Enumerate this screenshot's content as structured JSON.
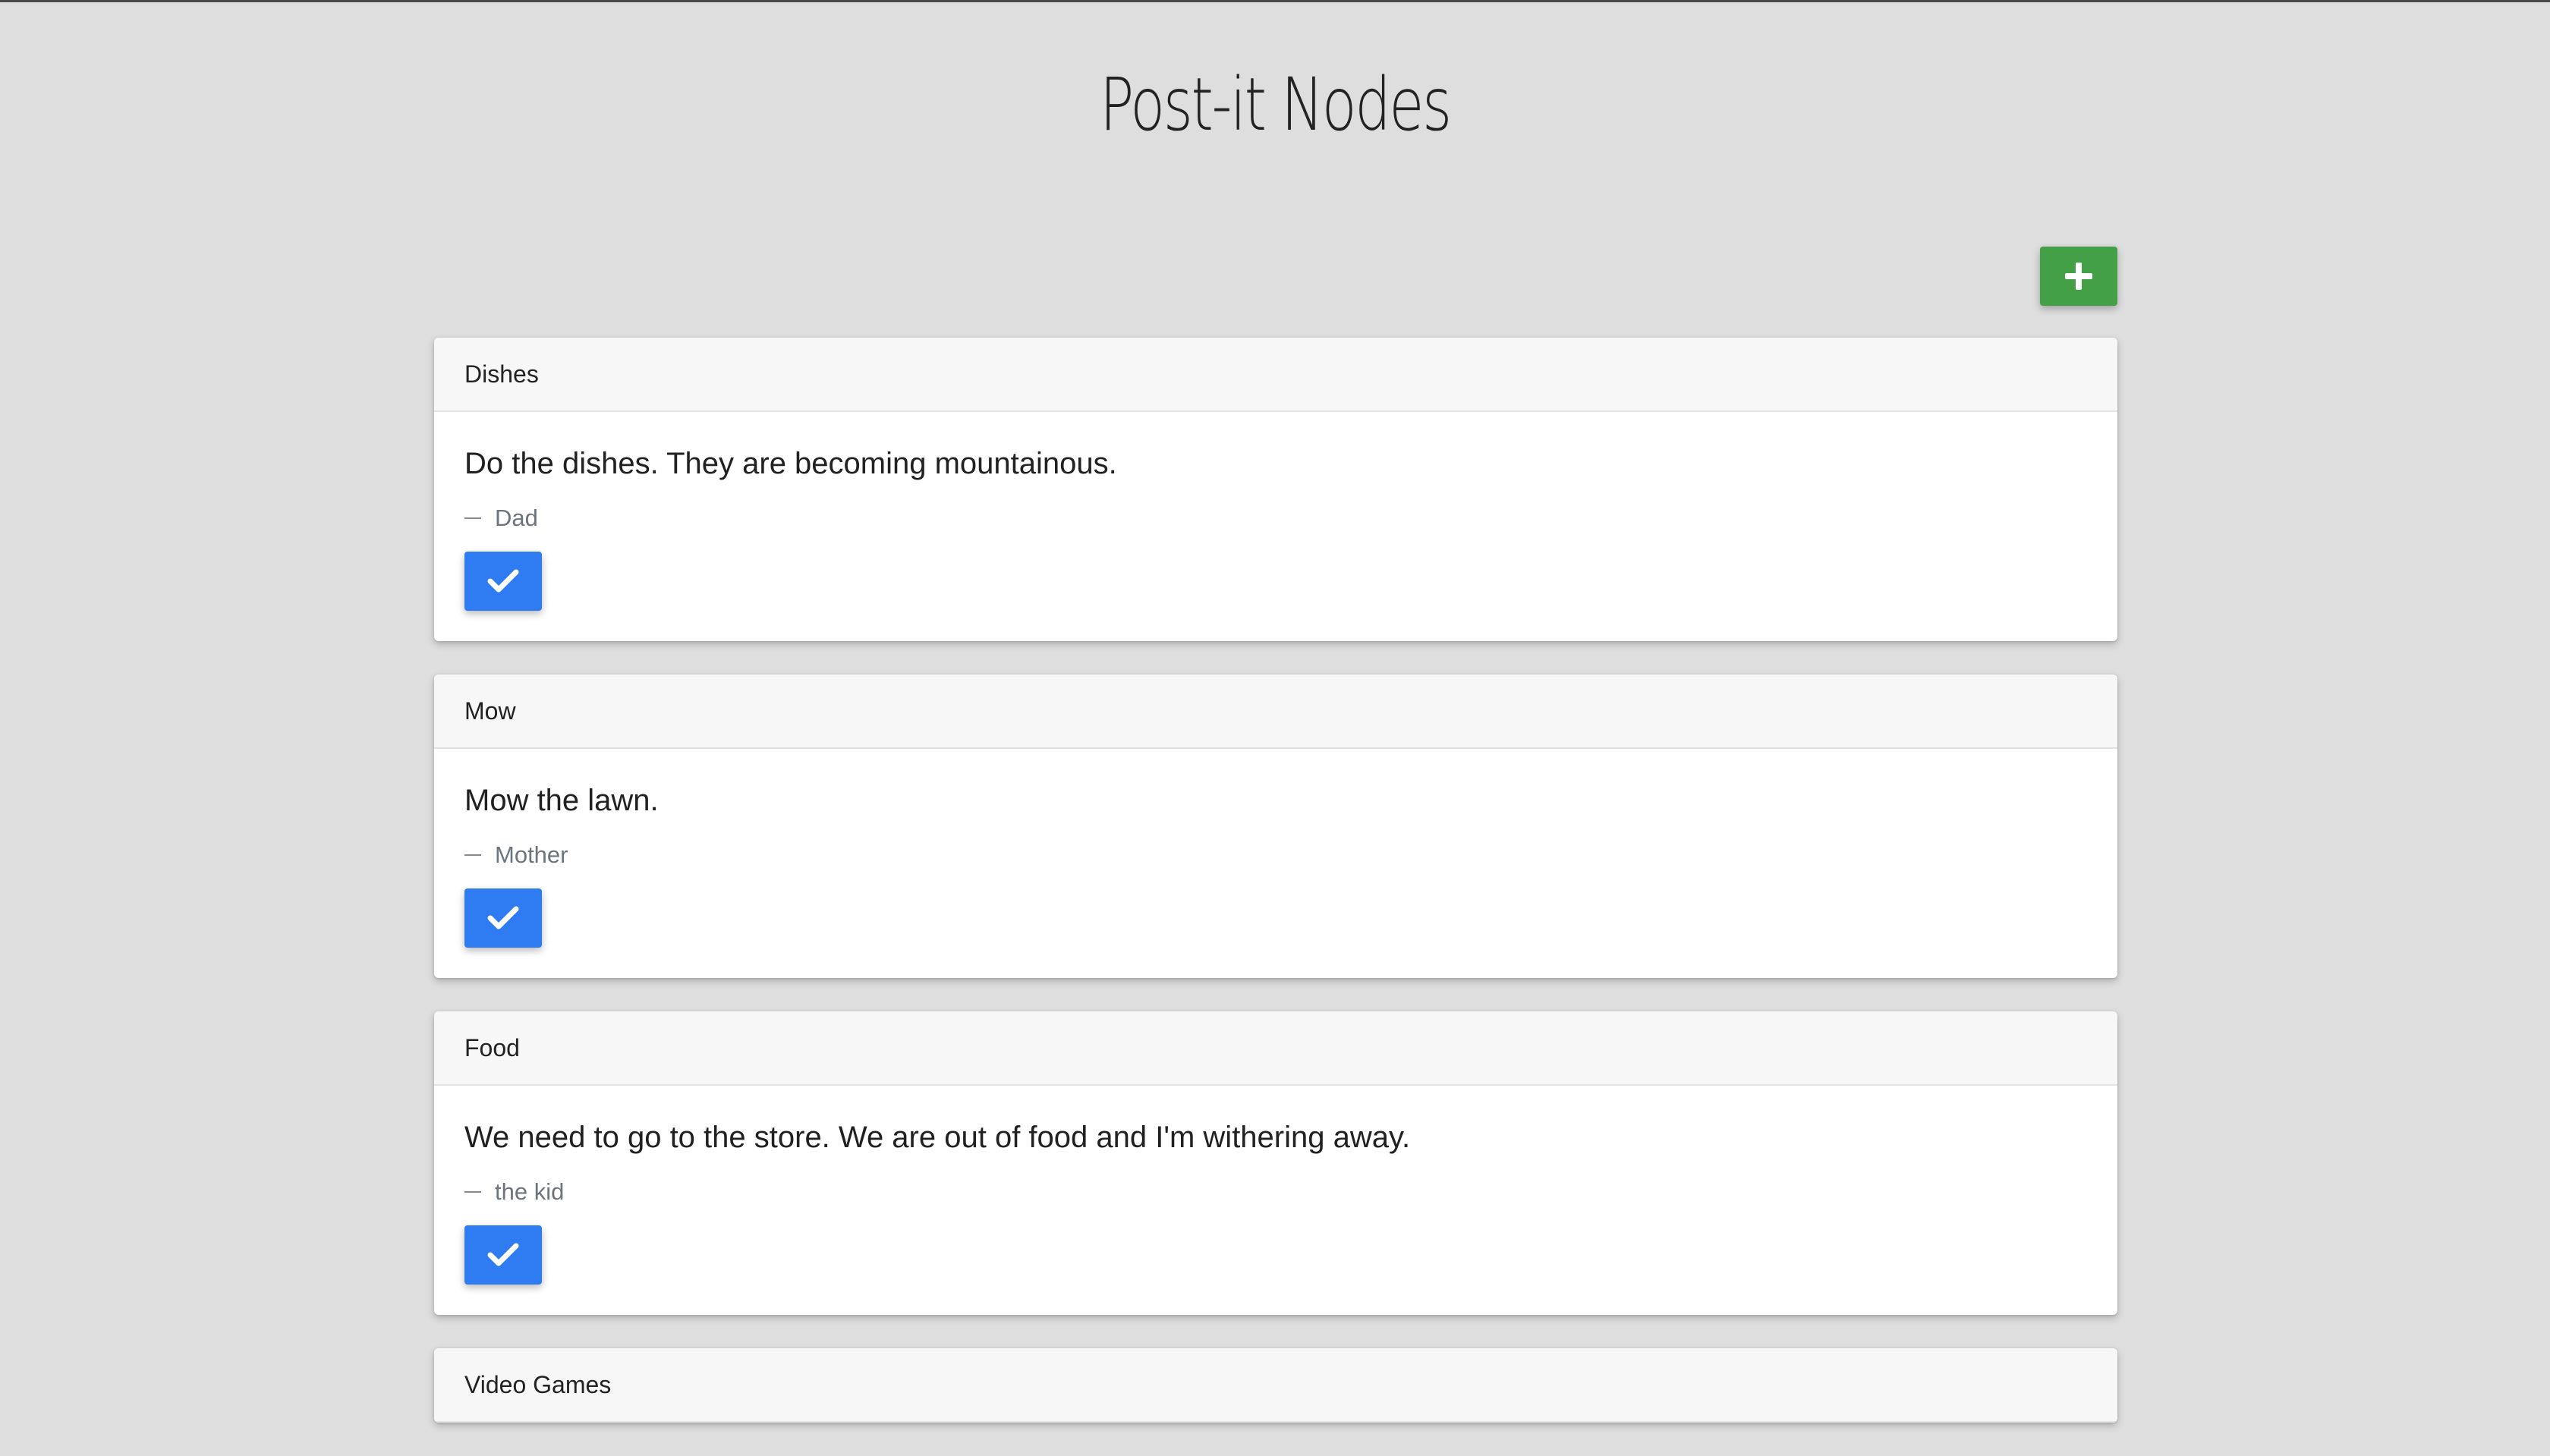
{
  "header": {
    "title": "Post-it Nodes"
  },
  "toolbar": {
    "add_icon": "plus-icon",
    "add_color": "#43a047"
  },
  "notes": [
    {
      "title": "Dishes",
      "text": "Do the dishes. They are becoming mountainous.",
      "author": "Dad"
    },
    {
      "title": "Mow",
      "text": "Mow the lawn.",
      "author": "Mother"
    },
    {
      "title": "Food",
      "text": "We need to go to the store. We are out of food and I'm withering away.",
      "author": "the kid"
    },
    {
      "title": "Video Games"
    }
  ],
  "note_actions": {
    "done_icon": "checkmark-icon",
    "done_color": "#2f7cf2"
  }
}
